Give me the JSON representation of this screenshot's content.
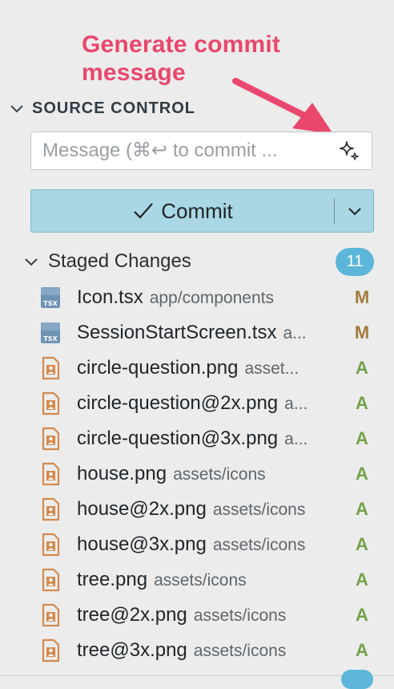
{
  "annotation": {
    "line1": "Generate commit",
    "line2": "message"
  },
  "panel": {
    "title": "SOURCE CONTROL"
  },
  "message": {
    "placeholder": "Message (⌘↩ to commit ...",
    "value": ""
  },
  "commit": {
    "label": "Commit"
  },
  "staged": {
    "label": "Staged Changes",
    "count": "11",
    "files": [
      {
        "name": "Icon.tsx",
        "path": "app/components",
        "status": "M",
        "icon": "tsx-file-icon"
      },
      {
        "name": "SessionStartScreen.tsx",
        "path": "a...",
        "status": "M",
        "icon": "tsx-file-icon"
      },
      {
        "name": "circle-question.png",
        "path": "asset...",
        "status": "A",
        "icon": "image-file-icon"
      },
      {
        "name": "circle-question@2x.png",
        "path": "a...",
        "status": "A",
        "icon": "image-file-icon"
      },
      {
        "name": "circle-question@3x.png",
        "path": "a...",
        "status": "A",
        "icon": "image-file-icon"
      },
      {
        "name": "house.png",
        "path": "assets/icons",
        "status": "A",
        "icon": "image-file-icon"
      },
      {
        "name": "house@2x.png",
        "path": "assets/icons",
        "status": "A",
        "icon": "image-file-icon"
      },
      {
        "name": "house@3x.png",
        "path": "assets/icons",
        "status": "A",
        "icon": "image-file-icon"
      },
      {
        "name": "tree.png",
        "path": "assets/icons",
        "status": "A",
        "icon": "image-file-icon"
      },
      {
        "name": "tree@2x.png",
        "path": "assets/icons",
        "status": "A",
        "icon": "image-file-icon"
      },
      {
        "name": "tree@3x.png",
        "path": "assets/icons",
        "status": "A",
        "icon": "image-file-icon"
      }
    ]
  },
  "colors": {
    "annotation": "#e9476c",
    "commit_button": "#a9d7e4",
    "badge": "#5cb6d9",
    "modified": "#a37a3a",
    "added": "#73a24a"
  }
}
